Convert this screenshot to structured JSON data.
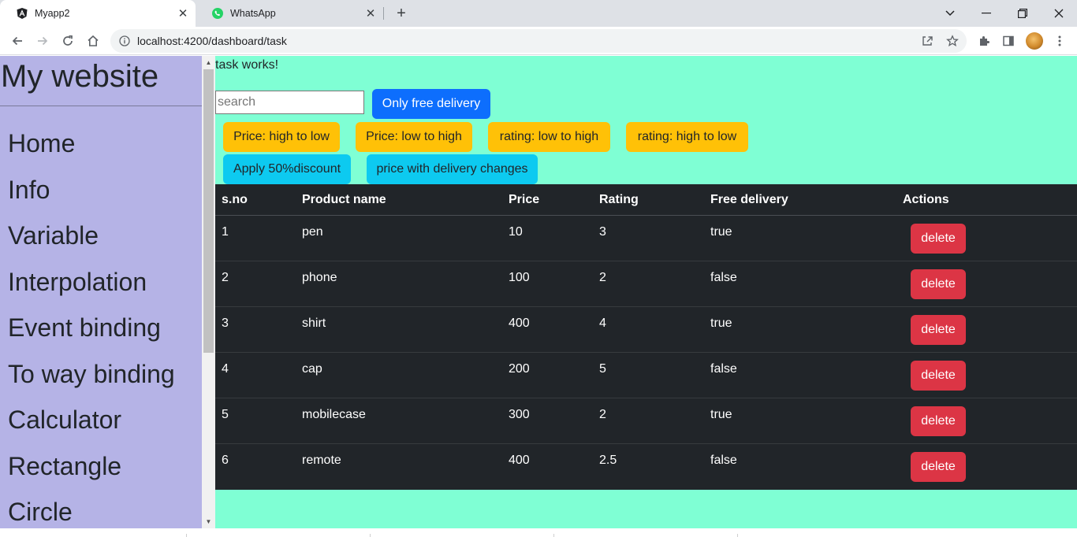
{
  "browser": {
    "tabs": [
      {
        "title": "Myapp2",
        "icon": "angular-icon"
      },
      {
        "title": "WhatsApp",
        "icon": "whatsapp-icon"
      }
    ],
    "url": "localhost:4200/dashboard/task"
  },
  "sidebar": {
    "brand": "My website",
    "items": [
      "Home",
      "Info",
      "Variable",
      "Interpolation",
      "Event binding",
      "To way binding",
      "Calculator",
      "Rectangle",
      "Circle"
    ]
  },
  "main": {
    "heading": "task works!",
    "search_placeholder": "search",
    "buttons": {
      "free_delivery": "Only free delivery",
      "price_high_low": "Price: high to low",
      "price_low_high": "Price: low to high",
      "rating_low_high": "rating: low to high",
      "rating_high_low": "rating: high to low",
      "discount": "Apply 50%discount",
      "delivery_changes": "price with delivery changes"
    },
    "table": {
      "headers": [
        "s.no",
        "Product name",
        "Price",
        "Rating",
        "Free delivery",
        "Actions"
      ],
      "rows": [
        [
          "1",
          "pen",
          "10",
          "3",
          "true"
        ],
        [
          "2",
          "phone",
          "100",
          "2",
          "false"
        ],
        [
          "3",
          "shirt",
          "400",
          "4",
          "true"
        ],
        [
          "4",
          "cap",
          "200",
          "5",
          "false"
        ],
        [
          "5",
          "mobilecase",
          "300",
          "2",
          "true"
        ],
        [
          "6",
          "remote",
          "400",
          "2.5",
          "false"
        ]
      ],
      "delete_label": "delete"
    }
  },
  "colors": {
    "sidebar_bg": "#b5b3e6",
    "main_bg": "#7fffd4",
    "table_bg": "#212529",
    "primary": "#0d6efd",
    "warning": "#ffc107",
    "info": "#0dcaf0",
    "danger": "#dc3545"
  }
}
